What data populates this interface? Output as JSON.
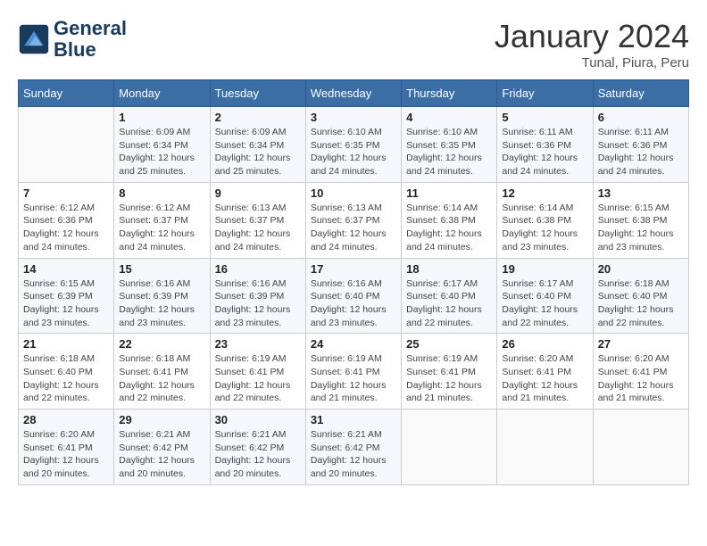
{
  "header": {
    "logo_line1": "General",
    "logo_line2": "Blue",
    "month": "January 2024",
    "location": "Tunal, Piura, Peru"
  },
  "days_of_week": [
    "Sunday",
    "Monday",
    "Tuesday",
    "Wednesday",
    "Thursday",
    "Friday",
    "Saturday"
  ],
  "weeks": [
    [
      {
        "day": "",
        "info": ""
      },
      {
        "day": "1",
        "info": "Sunrise: 6:09 AM\nSunset: 6:34 PM\nDaylight: 12 hours\nand 25 minutes."
      },
      {
        "day": "2",
        "info": "Sunrise: 6:09 AM\nSunset: 6:34 PM\nDaylight: 12 hours\nand 25 minutes."
      },
      {
        "day": "3",
        "info": "Sunrise: 6:10 AM\nSunset: 6:35 PM\nDaylight: 12 hours\nand 24 minutes."
      },
      {
        "day": "4",
        "info": "Sunrise: 6:10 AM\nSunset: 6:35 PM\nDaylight: 12 hours\nand 24 minutes."
      },
      {
        "day": "5",
        "info": "Sunrise: 6:11 AM\nSunset: 6:36 PM\nDaylight: 12 hours\nand 24 minutes."
      },
      {
        "day": "6",
        "info": "Sunrise: 6:11 AM\nSunset: 6:36 PM\nDaylight: 12 hours\nand 24 minutes."
      }
    ],
    [
      {
        "day": "7",
        "info": "Sunrise: 6:12 AM\nSunset: 6:36 PM\nDaylight: 12 hours\nand 24 minutes."
      },
      {
        "day": "8",
        "info": "Sunrise: 6:12 AM\nSunset: 6:37 PM\nDaylight: 12 hours\nand 24 minutes."
      },
      {
        "day": "9",
        "info": "Sunrise: 6:13 AM\nSunset: 6:37 PM\nDaylight: 12 hours\nand 24 minutes."
      },
      {
        "day": "10",
        "info": "Sunrise: 6:13 AM\nSunset: 6:37 PM\nDaylight: 12 hours\nand 24 minutes."
      },
      {
        "day": "11",
        "info": "Sunrise: 6:14 AM\nSunset: 6:38 PM\nDaylight: 12 hours\nand 24 minutes."
      },
      {
        "day": "12",
        "info": "Sunrise: 6:14 AM\nSunset: 6:38 PM\nDaylight: 12 hours\nand 23 minutes."
      },
      {
        "day": "13",
        "info": "Sunrise: 6:15 AM\nSunset: 6:38 PM\nDaylight: 12 hours\nand 23 minutes."
      }
    ],
    [
      {
        "day": "14",
        "info": "Sunrise: 6:15 AM\nSunset: 6:39 PM\nDaylight: 12 hours\nand 23 minutes."
      },
      {
        "day": "15",
        "info": "Sunrise: 6:16 AM\nSunset: 6:39 PM\nDaylight: 12 hours\nand 23 minutes."
      },
      {
        "day": "16",
        "info": "Sunrise: 6:16 AM\nSunset: 6:39 PM\nDaylight: 12 hours\nand 23 minutes."
      },
      {
        "day": "17",
        "info": "Sunrise: 6:16 AM\nSunset: 6:40 PM\nDaylight: 12 hours\nand 23 minutes."
      },
      {
        "day": "18",
        "info": "Sunrise: 6:17 AM\nSunset: 6:40 PM\nDaylight: 12 hours\nand 22 minutes."
      },
      {
        "day": "19",
        "info": "Sunrise: 6:17 AM\nSunset: 6:40 PM\nDaylight: 12 hours\nand 22 minutes."
      },
      {
        "day": "20",
        "info": "Sunrise: 6:18 AM\nSunset: 6:40 PM\nDaylight: 12 hours\nand 22 minutes."
      }
    ],
    [
      {
        "day": "21",
        "info": "Sunrise: 6:18 AM\nSunset: 6:40 PM\nDaylight: 12 hours\nand 22 minutes."
      },
      {
        "day": "22",
        "info": "Sunrise: 6:18 AM\nSunset: 6:41 PM\nDaylight: 12 hours\nand 22 minutes."
      },
      {
        "day": "23",
        "info": "Sunrise: 6:19 AM\nSunset: 6:41 PM\nDaylight: 12 hours\nand 22 minutes."
      },
      {
        "day": "24",
        "info": "Sunrise: 6:19 AM\nSunset: 6:41 PM\nDaylight: 12 hours\nand 21 minutes."
      },
      {
        "day": "25",
        "info": "Sunrise: 6:19 AM\nSunset: 6:41 PM\nDaylight: 12 hours\nand 21 minutes."
      },
      {
        "day": "26",
        "info": "Sunrise: 6:20 AM\nSunset: 6:41 PM\nDaylight: 12 hours\nand 21 minutes."
      },
      {
        "day": "27",
        "info": "Sunrise: 6:20 AM\nSunset: 6:41 PM\nDaylight: 12 hours\nand 21 minutes."
      }
    ],
    [
      {
        "day": "28",
        "info": "Sunrise: 6:20 AM\nSunset: 6:41 PM\nDaylight: 12 hours\nand 20 minutes."
      },
      {
        "day": "29",
        "info": "Sunrise: 6:21 AM\nSunset: 6:42 PM\nDaylight: 12 hours\nand 20 minutes."
      },
      {
        "day": "30",
        "info": "Sunrise: 6:21 AM\nSunset: 6:42 PM\nDaylight: 12 hours\nand 20 minutes."
      },
      {
        "day": "31",
        "info": "Sunrise: 6:21 AM\nSunset: 6:42 PM\nDaylight: 12 hours\nand 20 minutes."
      },
      {
        "day": "",
        "info": ""
      },
      {
        "day": "",
        "info": ""
      },
      {
        "day": "",
        "info": ""
      }
    ]
  ]
}
